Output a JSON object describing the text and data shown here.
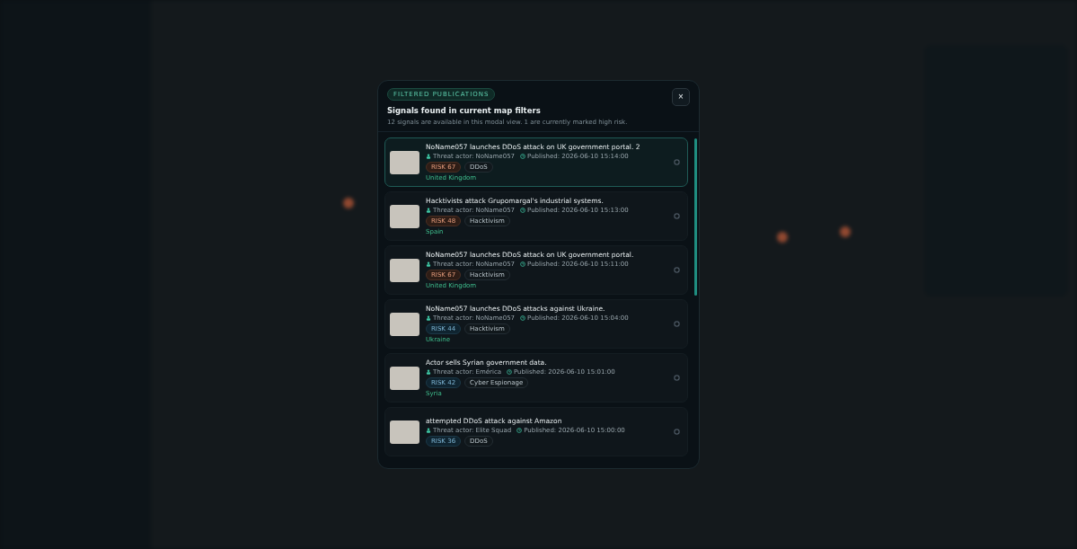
{
  "modal": {
    "badge": "FILTERED PUBLICATIONS",
    "title": "Signals found in current map filters",
    "subtitle": "12 signals are available in this modal view. 1 are currently marked high risk.",
    "close": "×"
  },
  "items": [
    {
      "title": "NoName057 launches DDoS attack on UK government portal. 2",
      "actor": "Threat actor: NoName057",
      "published": "Published: 2026-06-10 15:14:00",
      "risk": "RISK 67",
      "high_risk": true,
      "tag": "DDoS",
      "country": "United Kingdom",
      "selected": true
    },
    {
      "title": "Hacktivists attack Grupomargal's industrial systems.",
      "actor": "Threat actor: NoName057",
      "published": "Published: 2026-06-10 15:13:00",
      "risk": "RISK 48",
      "high_risk": true,
      "tag": "Hacktivism",
      "country": "Spain",
      "selected": false
    },
    {
      "title": "NoName057 launches DDoS attack on UK government portal.",
      "actor": "Threat actor: NoName057",
      "published": "Published: 2026-06-10 15:11:00",
      "risk": "RISK 67",
      "high_risk": true,
      "tag": "Hacktivism",
      "country": "United Kingdom",
      "selected": false
    },
    {
      "title": "NoName057 launches DDoS attacks against Ukraine.",
      "actor": "Threat actor: NoName057",
      "published": "Published: 2026-06-10 15:04:00",
      "risk": "RISK 44",
      "high_risk": false,
      "tag": "Hacktivism",
      "country": "Ukraine",
      "selected": false
    },
    {
      "title": "Actor sells Syrian government data.",
      "actor": "Threat actor: Emérica",
      "published": "Published: 2026-06-10 15:01:00",
      "risk": "RISK 42",
      "high_risk": false,
      "tag": "Cyber Espionage",
      "country": "Syria",
      "selected": false
    },
    {
      "title": "attempted DDoS attack against Amazon",
      "actor": "Threat actor: Elite Squad",
      "published": "Published: 2026-06-10 15:00:00",
      "risk": "RISK 36",
      "high_risk": false,
      "tag": "DDoS",
      "selected": false
    }
  ]
}
